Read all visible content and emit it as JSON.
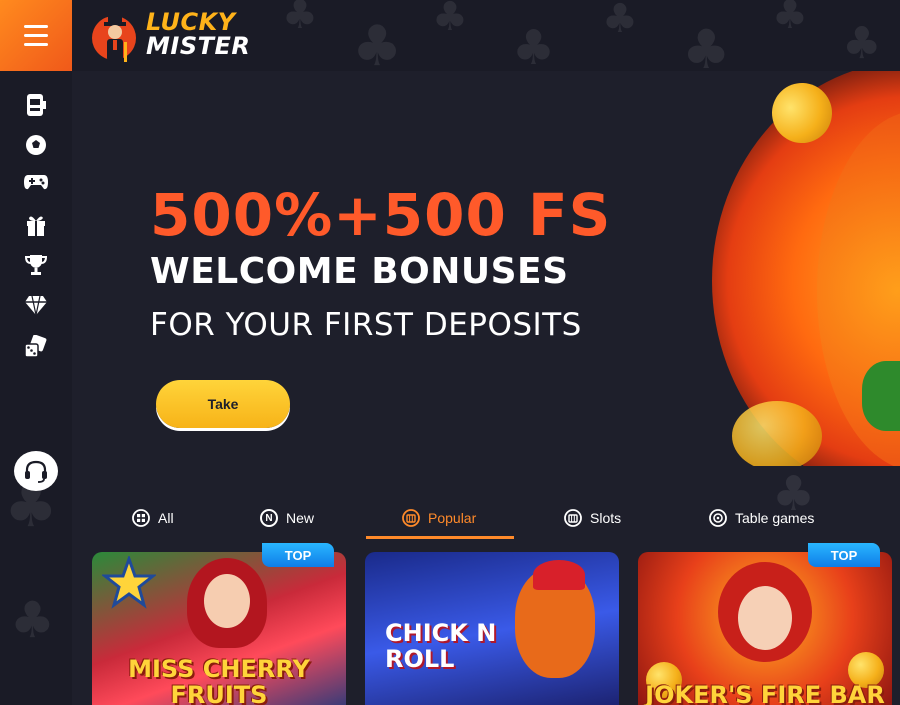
{
  "header": {
    "menu_icon": "hamburger-icon",
    "logo": {
      "line1": "LUCKY",
      "line2": "MISTER"
    }
  },
  "sidebar": {
    "items": [
      {
        "icon": "slot-machine-icon"
      },
      {
        "icon": "soccer-ball-icon"
      },
      {
        "icon": "gamepad-icon"
      },
      {
        "icon": "gift-icon"
      },
      {
        "icon": "trophy-icon"
      },
      {
        "icon": "diamond-icon"
      },
      {
        "icon": "dice-icon"
      }
    ],
    "support_icon": "headset-icon"
  },
  "hero": {
    "title": "500%+500 FS",
    "subtitle": "WELCOME BONUSES",
    "tagline": "FOR YOUR FIRST DEPOSITS",
    "cta_label": "Take"
  },
  "tabs": [
    {
      "label": "All",
      "icon": "grid-icon",
      "active": false
    },
    {
      "label": "New",
      "icon": "new-icon",
      "active": false
    },
    {
      "label": "Popular",
      "icon": "popular-icon",
      "active": true
    },
    {
      "label": "Slots",
      "icon": "slots-icon",
      "active": false
    },
    {
      "label": "Table games",
      "icon": "table-games-icon",
      "active": false
    }
  ],
  "games": [
    {
      "title": "MISS CHERRY FRUITS",
      "badge": "TOP"
    },
    {
      "title": "CHICK N ROLL",
      "badge": ""
    },
    {
      "title": "JOKER'S FIRE BAR",
      "badge": "TOP"
    }
  ],
  "colors": {
    "accent": "#ff8a2a",
    "hero_title": "#ff5a2a",
    "cta": "#f7b318",
    "background": "#1e1f2b",
    "badge": "#0f7de8"
  }
}
